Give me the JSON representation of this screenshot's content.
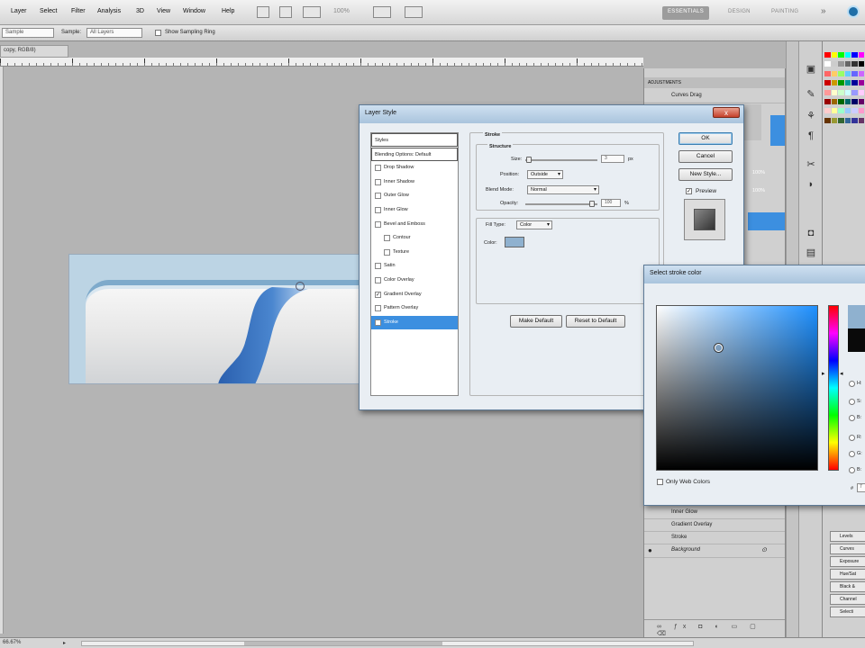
{
  "menu": {
    "items": [
      "Layer",
      "Select",
      "Filter",
      "Analysis",
      "3D",
      "View",
      "Window",
      "Help"
    ],
    "zoom": "100%",
    "workspaces": [
      "ESSENTIALS",
      "DESIGN",
      "PAINTING"
    ],
    "overflow": "»"
  },
  "options": {
    "sample_size": "Sample",
    "sample_label": "Sample:",
    "sample_value": "All Layers",
    "show_ring": "Show Sampling Ring"
  },
  "document": {
    "tab": "copy, RGB/8)",
    "status": "66.67%"
  },
  "layer_style": {
    "title": "Layer Style",
    "close": "x",
    "sidebar": [
      {
        "label": "Styles",
        "type": "head"
      },
      {
        "label": "Blending Options: Default",
        "type": "head"
      },
      {
        "label": "Drop Shadow",
        "checked": false
      },
      {
        "label": "Inner Shadow",
        "checked": false
      },
      {
        "label": "Outer Glow",
        "checked": false
      },
      {
        "label": "Inner Glow",
        "checked": false
      },
      {
        "label": "Bevel and Emboss",
        "checked": false
      },
      {
        "label": "Contour",
        "checked": false,
        "indent": true
      },
      {
        "label": "Texture",
        "checked": false,
        "indent": true
      },
      {
        "label": "Satin",
        "checked": false
      },
      {
        "label": "Color Overlay",
        "checked": false
      },
      {
        "label": "Gradient Overlay",
        "checked": true
      },
      {
        "label": "Pattern Overlay",
        "checked": false
      },
      {
        "label": "Stroke",
        "checked": true,
        "selected": true
      }
    ],
    "section_title": "Stroke",
    "structure_title": "Structure",
    "size_label": "Size:",
    "size_value": "3",
    "size_unit": "px",
    "position_label": "Position:",
    "position_value": "Outside",
    "blend_label": "Blend Mode:",
    "blend_value": "Normal",
    "opacity_label": "Opacity:",
    "opacity_value": "100",
    "opacity_unit": "%",
    "filltype_label": "Fill Type:",
    "filltype_value": "Color",
    "color_label": "Color:",
    "stroke_color": "#8fb1cf",
    "make_default": "Make Default",
    "reset_default": "Reset to Default",
    "ok": "OK",
    "cancel": "Cancel",
    "new_style": "New Style...",
    "preview": "Preview"
  },
  "color_picker": {
    "title": "Select stroke color",
    "only_web": "Only Web Colors",
    "new_color": "#8fb1cf",
    "current_color": "#0a0a0a",
    "radios": [
      "H:",
      "S:",
      "B:",
      "R:",
      "G:",
      "B:"
    ],
    "hex_label": "#",
    "hex_value": "7"
  },
  "layers_panel": {
    "tab": "ADJUSTMENTS",
    "top_item": "Curves Drag",
    "effects": [
      "Inner Glow",
      "Gradient Overlay",
      "Stroke"
    ],
    "background": "Background",
    "blend_values": [
      "100%",
      "100%"
    ]
  },
  "adjustments": [
    "Levels",
    "Curves",
    "Exposure",
    "Hue/Sat",
    "Black &",
    "Channel",
    "Selecti"
  ]
}
